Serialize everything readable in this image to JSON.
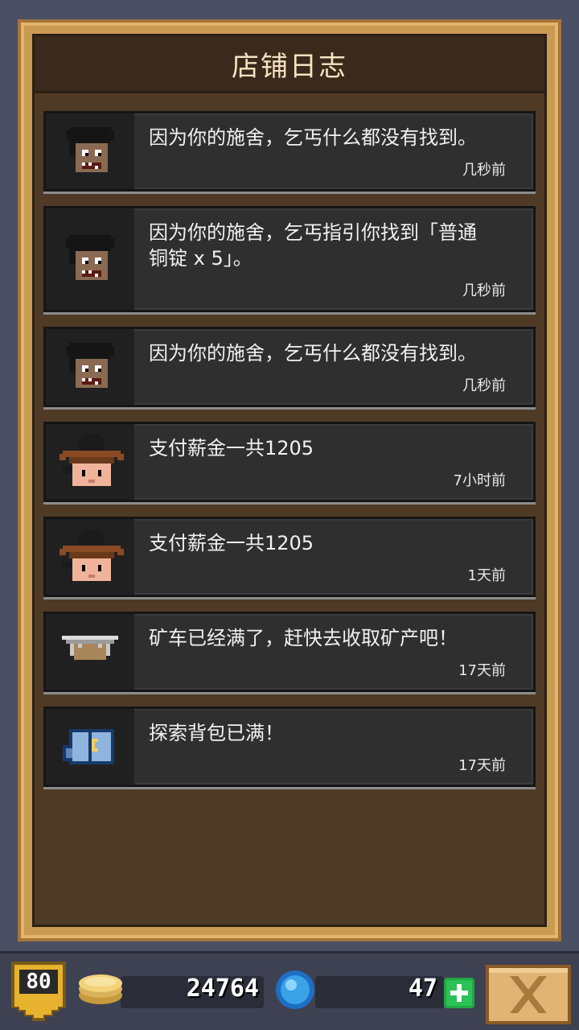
{
  "header": {
    "title": "店铺日志"
  },
  "logs": [
    {
      "avatar": "beggar-icon",
      "message": "因为你的施舍，乞丐什么都没有找到。",
      "time": "几秒前"
    },
    {
      "avatar": "beggar-icon",
      "message": "因为你的施舍，乞丐指引你找到「普通\n铜锭 x 5」。",
      "time": "几秒前"
    },
    {
      "avatar": "beggar-icon",
      "message": "因为你的施舍，乞丐什么都没有找到。",
      "time": "几秒前"
    },
    {
      "avatar": "cowboy-hat-worker-icon",
      "message": "支付薪金一共1205",
      "time": "7小时前"
    },
    {
      "avatar": "cowboy-hat-worker-icon",
      "message": "支付薪金一共1205",
      "time": "1天前"
    },
    {
      "avatar": "mine-cart-icon",
      "message": "矿车已经满了，赶快去收取矿产吧！",
      "time": "17天前"
    },
    {
      "avatar": "backpack-icon",
      "message": "探索背包已满！",
      "time": "17天前"
    }
  ],
  "footer": {
    "level": "80",
    "coins": "24764",
    "gems": "47",
    "icons": {
      "level": "shield-badge-icon",
      "coin": "coin-stack-icon",
      "gem": "blue-gem-icon",
      "add": "plus-icon",
      "close": "close-x-icon"
    },
    "colors": {
      "add_button": "#1fa845",
      "coin": "#f2d27a",
      "gem": "#3aa3e8"
    }
  }
}
